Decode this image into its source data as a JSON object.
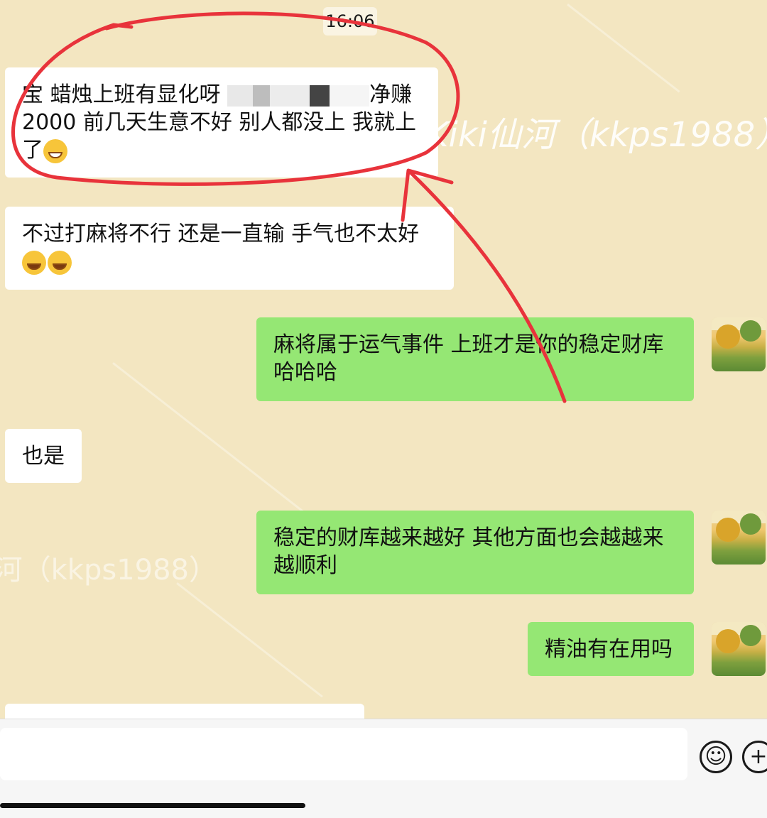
{
  "chat": {
    "timestamp": "16:06",
    "watermark_text": "Kiki仙河（kkps1988）",
    "messages": [
      {
        "side": "left",
        "text": "宝 蜡烛上班有显化呀",
        "text_after_redaction": "净赚",
        "line2": "2000 前几天生意不好 别人都没上 我就上",
        "line3": "了",
        "emoji": "grin"
      },
      {
        "side": "left",
        "text": "不过打麻将不行  还是一直输 手气也不太好",
        "emoji": "cry"
      },
      {
        "side": "right",
        "text": "麻将属于运气事件 上班才是你的稳定财库",
        "line2": "哈哈哈"
      },
      {
        "side": "left",
        "text": "也是"
      },
      {
        "side": "right",
        "text": "稳定的财库越来越好 其他方面也会越越来",
        "line2": "越顺利"
      },
      {
        "side": "right",
        "text": "精油有在用吗"
      }
    ]
  },
  "input_bar": {
    "emoji_button": "☺",
    "plus_button": "+"
  },
  "colors": {
    "chat_bg": "#f3e6c1",
    "left_bubble": "#ffffff",
    "right_bubble": "#95e774",
    "annotation": "#e8333b"
  }
}
